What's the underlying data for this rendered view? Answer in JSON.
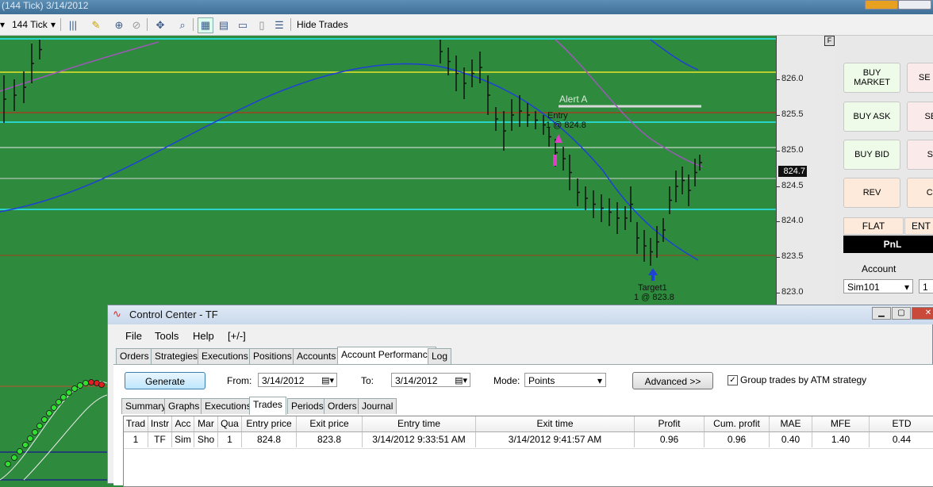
{
  "chart_window": {
    "title": "(144 Tick) 3/14/2012",
    "interval": "144 Tick",
    "hide_trades_label": "Hide Trades"
  },
  "price_axis": {
    "ticks": [
      "826.0",
      "825.5",
      "825.0",
      "824.5",
      "824.0",
      "823.5",
      "823.0"
    ],
    "last_price": "824.7"
  },
  "chart_labels": {
    "alert": "Alert A",
    "entry_line1": "Entry",
    "entry_line2": "1 @ 824.8",
    "target_line1": "Target1",
    "target_line2": "1 @ 823.8",
    "panel_flag": "F"
  },
  "chart_trader": {
    "buy_market": "BUY MARKET",
    "sell_market": "SE MAR",
    "buy_ask": "BUY ASK",
    "sell_ask": "SELL",
    "buy_bid": "BUY BID",
    "sell_bid": "SEL",
    "rev": "REV",
    "close": "CLO",
    "flat": "FLAT",
    "entry": "ENT",
    "pnl": "PnL",
    "account_label": "Account",
    "account_value": "Sim101",
    "qty_value": "1"
  },
  "control_center": {
    "title": "Control Center - TF",
    "menu": [
      "File",
      "Tools",
      "Help",
      "[+/-]"
    ],
    "tabs": [
      "Orders",
      "Strategies",
      "Executions",
      "Positions",
      "Accounts",
      "Account Performance",
      "Log"
    ],
    "generate": "Generate",
    "from_label": "From:",
    "from_value": "3/14/2012",
    "to_label": "To:",
    "to_value": "3/14/2012",
    "mode_label": "Mode:",
    "mode_value": "Points",
    "advanced": "Advanced >>",
    "group_label": "Group trades by ATM strategy",
    "subtabs": [
      "Summary",
      "Graphs",
      "Executions",
      "Trades",
      "Periods",
      "Orders",
      "Journal"
    ],
    "columns": [
      "Trad",
      "Instr",
      "Acc",
      "Mar",
      "Qua",
      "Entry price",
      "Exit price",
      "Entry time",
      "Exit time",
      "Profit",
      "Cum. profit",
      "MAE",
      "MFE",
      "ETD"
    ],
    "rows": [
      [
        "1",
        "TF",
        "Sim",
        "Sho",
        "1",
        "824.8",
        "823.8",
        "3/14/2012 9:33:51 AM",
        "3/14/2012 9:41:57 AM",
        "0.96",
        "0.96",
        "0.40",
        "1.40",
        "0.44"
      ]
    ]
  },
  "colors": {
    "chart_bg": "#2e8b3e",
    "ma_blue": "#1f3fd6",
    "ma_purple": "#9b59b6",
    "cyan_line": "#2bd4c8",
    "yellow_line": "#e6e62a",
    "entry_marker": "#e040c8"
  }
}
